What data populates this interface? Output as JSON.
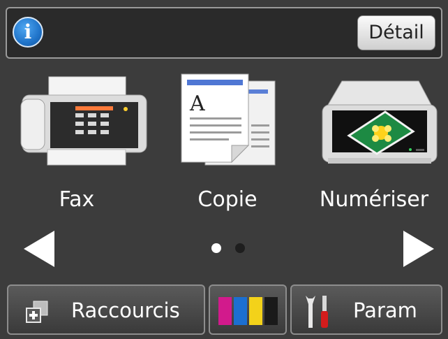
{
  "topbar": {
    "info_icon": "i",
    "detail_label": "Détail"
  },
  "tiles": [
    {
      "label": "Fax",
      "icon": "fax-machine-icon"
    },
    {
      "label": "Copie",
      "icon": "copy-documents-icon"
    },
    {
      "label": "Numériser",
      "icon": "scanner-icon"
    }
  ],
  "copy_icon_letter": "A",
  "pagination": {
    "current_page": 1,
    "total_pages": 2
  },
  "bottom": {
    "shortcuts_label": "Raccourcis",
    "ink_colors": [
      "#d21a8c",
      "#1c6fd1",
      "#f3d21a",
      "#1a1a1a"
    ],
    "settings_label": "Param"
  },
  "colors": {
    "accent_blue": "#1f73c9",
    "background": "#3c3c3c"
  }
}
